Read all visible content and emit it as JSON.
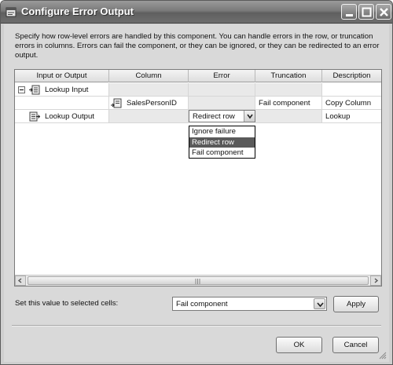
{
  "window": {
    "title": "Configure Error Output",
    "title_controls": [
      "minimize",
      "maximize",
      "close"
    ]
  },
  "description": "Specify how row-level errors are handled by this component. You can handle errors in the row, or truncation errors in columns. Errors can fail the component, or they can be ignored, or they can be redirected to an error output.",
  "grid": {
    "columns": [
      "Input or Output",
      "Column",
      "Error",
      "Truncation",
      "Description"
    ],
    "rows": [
      {
        "input_or_output": "Lookup Input",
        "column": "",
        "error": "",
        "truncation": "",
        "description": ""
      },
      {
        "input_or_output": "",
        "column": "SalesPersonID",
        "error": "",
        "truncation": "Fail component",
        "description": "Copy Column"
      },
      {
        "input_or_output": "Lookup Output",
        "column": "",
        "error": "Redirect row",
        "truncation": "",
        "description": "Lookup"
      }
    ],
    "error_dropdown": {
      "selected": "Redirect row",
      "options": [
        "Ignore failure",
        "Redirect row",
        "Fail component"
      ]
    }
  },
  "footer": {
    "set_label": "Set this value to selected cells:",
    "set_value": "Fail component",
    "apply_label": "Apply",
    "ok_label": "OK",
    "cancel_label": "Cancel"
  },
  "colors": {
    "titlebar": "#6e6e6e",
    "dialog_bg": "#d9d9d9",
    "selection": "#5a5a5a"
  }
}
